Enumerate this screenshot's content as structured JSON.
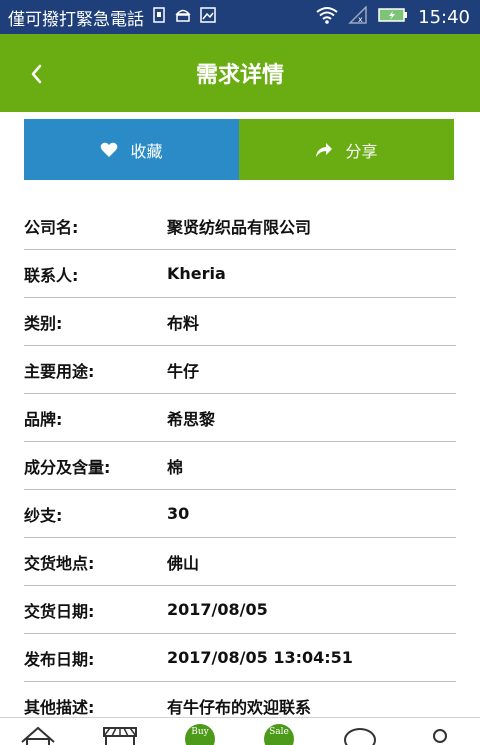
{
  "status_bar": {
    "carrier_text": "僅可撥打緊急電話",
    "time": "15:40",
    "icons": [
      "sim-icon",
      "android-icon",
      "image-icon",
      "wifi-icon",
      "signal-icon",
      "battery-charging-icon"
    ],
    "background_color": "#1e3f7a"
  },
  "header": {
    "title": "需求详情",
    "back_icon": "back-arrow-icon",
    "background_color": "#6aad12"
  },
  "actions": {
    "favorite_label": "收藏",
    "favorite_icon": "heart-icon",
    "favorite_color": "#2b8bc6",
    "share_label": "分享",
    "share_icon": "share-icon",
    "share_color": "#6aad12"
  },
  "details": [
    {
      "label": "公司名:",
      "value": "聚贤纺织品有限公司"
    },
    {
      "label": "联系人:",
      "value": "Kheria"
    },
    {
      "label": "类别:",
      "value": "布料"
    },
    {
      "label": "主要用途:",
      "value": "牛仔"
    },
    {
      "label": "品牌:",
      "value": "希思黎"
    },
    {
      "label": "成分及含量:",
      "value": "棉"
    },
    {
      "label": "纱支:",
      "value": "30"
    },
    {
      "label": "交货地点:",
      "value": "佛山"
    },
    {
      "label": "交货日期:",
      "value": "2017/08/05"
    },
    {
      "label": "发布日期:",
      "value": "2017/08/05 13:04:51"
    },
    {
      "label": "其他描述:",
      "value": "有牛仔布的欢迎联系"
    }
  ],
  "bottom_nav": {
    "items": [
      {
        "icon": "home-icon"
      },
      {
        "icon": "store-icon"
      },
      {
        "icon": "buy-badge-icon",
        "badge_text": "Buy"
      },
      {
        "icon": "sale-badge-icon",
        "badge_text": "Sale"
      },
      {
        "icon": "chat-bubble-icon"
      },
      {
        "icon": "profile-icon"
      }
    ]
  }
}
